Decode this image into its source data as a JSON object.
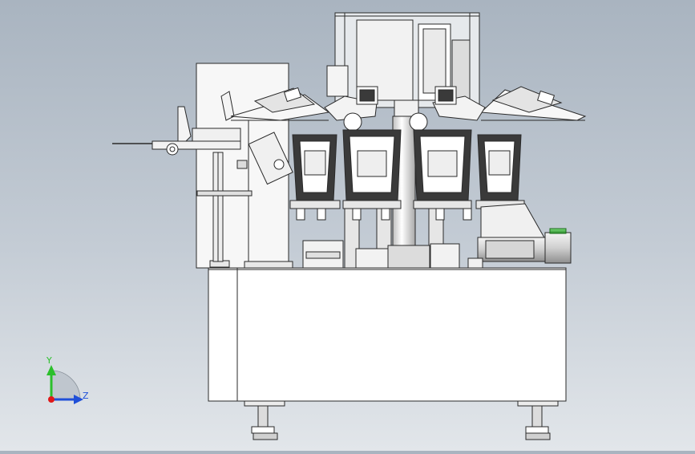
{
  "view": {
    "background_top": "#a9b4c0",
    "background_bottom": "#e2e6ea",
    "line_color": "#2a2a2a",
    "part_fill": "#ffffff",
    "shade_fill": "#d8dde3"
  },
  "triad": {
    "y_label": "Y",
    "z_label": "Z",
    "y_color": "#2bbf2b",
    "z_color": "#1f4fd8",
    "x_color": "#e01818"
  }
}
